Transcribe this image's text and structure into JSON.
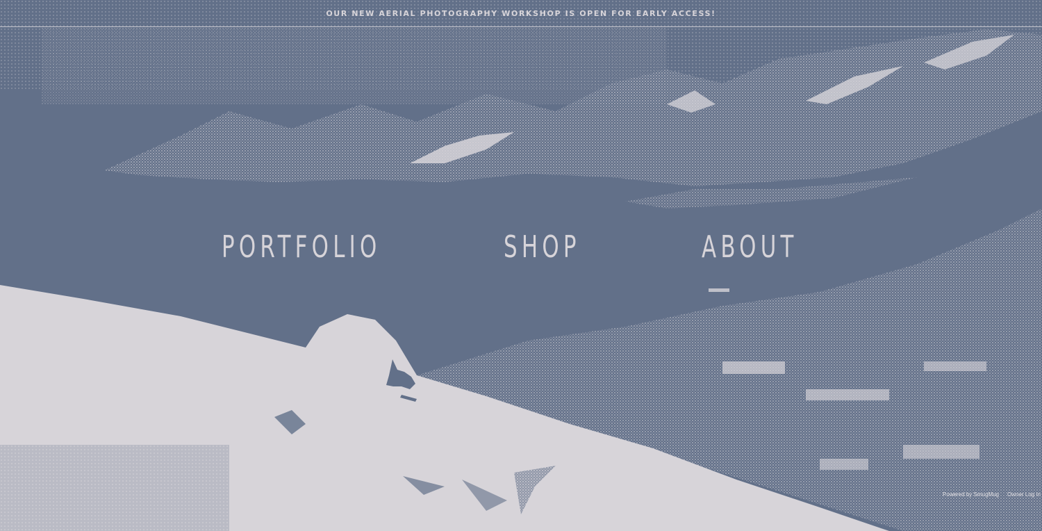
{
  "announcement": {
    "text": "OUR NEW AERIAL PHOTOGRAPHY WORKSHOP IS OPEN FOR EARLY ACCESS!"
  },
  "nav": {
    "items": [
      {
        "label": "PORTFOLIO"
      },
      {
        "label": "SHOP"
      },
      {
        "label": "ABOUT"
      }
    ]
  },
  "footer": {
    "powered_by": "Powered by SmugMug",
    "owner_login": "Owner Log In"
  },
  "colors": {
    "background": "#627089",
    "foreground": "#d7d4d9"
  },
  "hero": {
    "icon": "snowboarder-mountain-photo"
  }
}
